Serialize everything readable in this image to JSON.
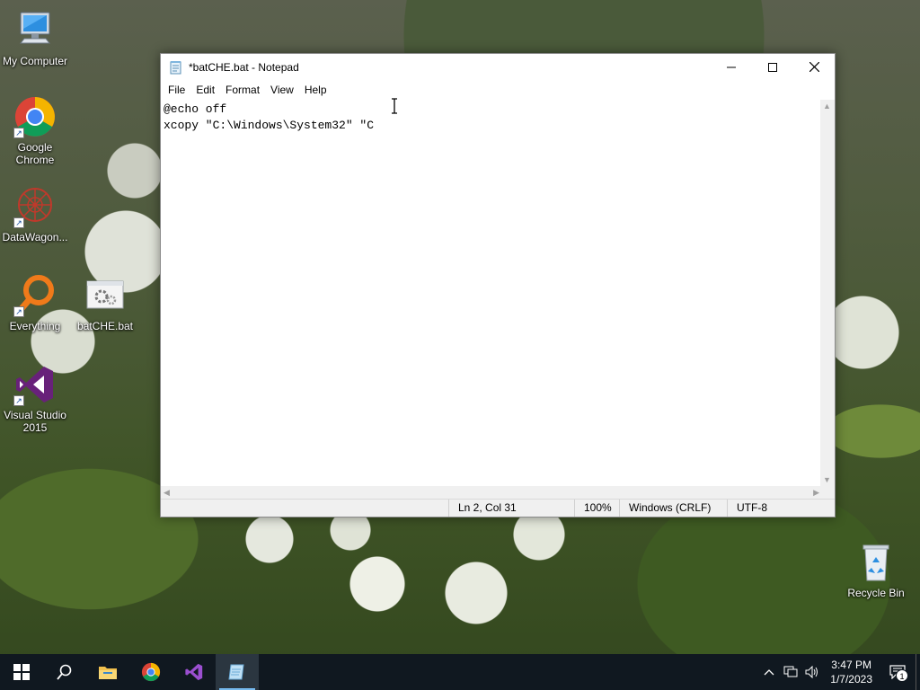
{
  "desktop": {
    "icons": [
      {
        "label": "My Computer"
      },
      {
        "label": "Google Chrome"
      },
      {
        "label": "DataWagon..."
      },
      {
        "label": "Everything"
      },
      {
        "label": "batCHE.bat"
      },
      {
        "label": "Visual Studio 2015"
      },
      {
        "label": "Recycle Bin"
      }
    ]
  },
  "notepad": {
    "title": "*batCHE.bat - Notepad",
    "menu": [
      "File",
      "Edit",
      "Format",
      "View",
      "Help"
    ],
    "content": "@echo off\nxcopy \"C:\\Windows\\System32\" \"C",
    "status": {
      "position": "Ln 2, Col 31",
      "zoom": "100%",
      "line_ending": "Windows (CRLF)",
      "encoding": "UTF-8"
    }
  },
  "taskbar": {
    "time": "3:47 PM",
    "date": "1/7/2023",
    "notification_count": "1"
  }
}
